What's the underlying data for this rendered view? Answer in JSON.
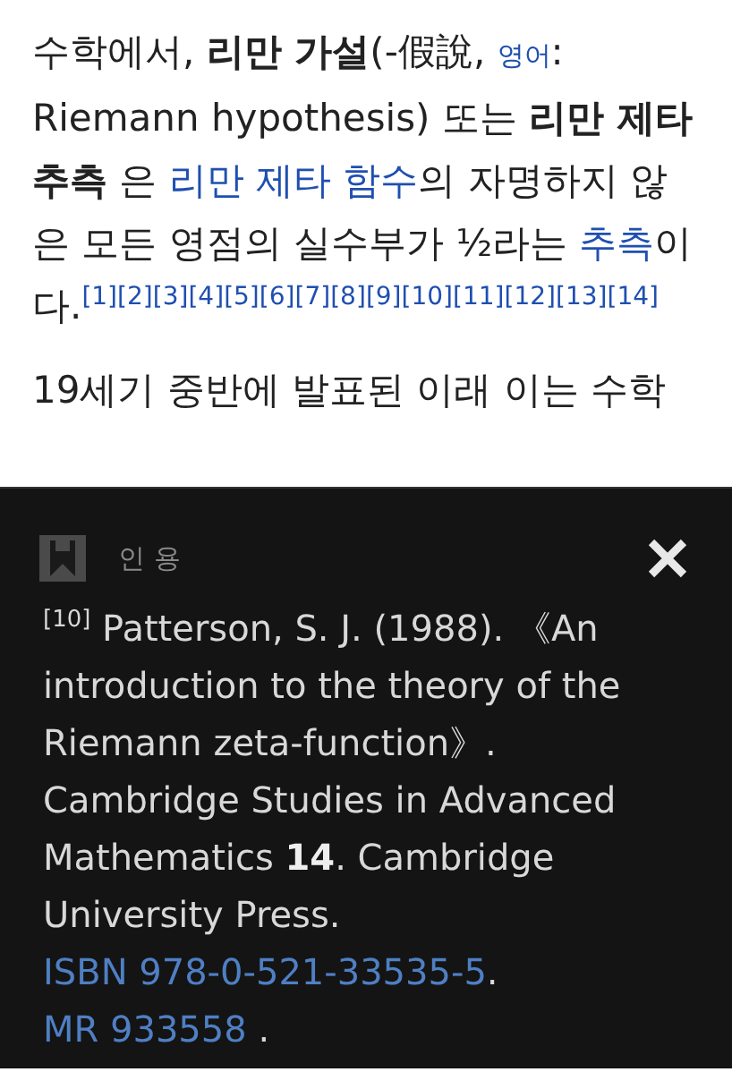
{
  "article": {
    "segments": [
      {
        "kind": "plain",
        "text": "수학에서, "
      },
      {
        "kind": "bold",
        "text": "리만 가설"
      },
      {
        "kind": "plain",
        "text": "(-假說, "
      },
      {
        "kind": "small_link",
        "text": "영어"
      },
      {
        "kind": "plain",
        "text": ": Riemann hypothesis) 또는 "
      },
      {
        "kind": "bold",
        "text": "리만 제타 추측"
      },
      {
        "kind": "plain",
        "text": " 은 "
      },
      {
        "kind": "link",
        "text": "리만 제타 함수"
      },
      {
        "kind": "plain",
        "text": "의 자명하지 않은 모든 영점의 실수부가 ½라는 "
      },
      {
        "kind": "link",
        "text": "추측"
      },
      {
        "kind": "plain",
        "text": "이다."
      }
    ],
    "refs": [
      "[1]",
      "[2]",
      "[3]",
      "[4]",
      "[5]",
      "[6]",
      "[7]",
      "[8]",
      "[9]",
      "[10]",
      "[11]",
      "[12]",
      "[13]",
      "[14]"
    ],
    "next_paragraph": "19세기 중반에 발표된 이래 이는 수학"
  },
  "citation_popup": {
    "title": "인 용",
    "segments": [
      {
        "kind": "sup",
        "text": "[10]"
      },
      {
        "kind": "plain",
        "text": " Patterson, S. J. (1988). 《An introduction to the theory of the Riemann zeta-function》. Cambridge Studies in Advanced Mathematics "
      },
      {
        "kind": "bold",
        "text": "14"
      },
      {
        "kind": "plain",
        "text": ". Cambridge University Press. "
      },
      {
        "kind": "link",
        "text": "ISBN 978-0-521-33535-5"
      },
      {
        "kind": "plain",
        "text": ". "
      },
      {
        "kind": "link",
        "text": "MR 933558"
      },
      {
        "kind": "plain",
        "text": " ."
      }
    ]
  }
}
